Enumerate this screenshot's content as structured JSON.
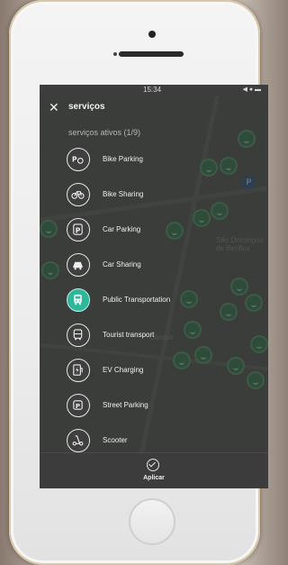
{
  "status_bar": {
    "time": "15:34",
    "icons": "◀ ● ▬"
  },
  "header": {
    "close_icon": "close-icon",
    "title": "serviços"
  },
  "subtitle": "serviços ativos (1/9)",
  "services": [
    {
      "label": "Bike Parking",
      "icon": "bike-parking-icon",
      "active": false
    },
    {
      "label": "Bike Sharing",
      "icon": "bike-icon",
      "active": false
    },
    {
      "label": "Car Parking",
      "icon": "car-parking-icon",
      "active": false
    },
    {
      "label": "Car Sharing",
      "icon": "car-icon",
      "active": false
    },
    {
      "label": "Public Transportation",
      "icon": "bus-icon",
      "active": true
    },
    {
      "label": "Tourist transport",
      "icon": "tourist-bus-icon",
      "active": false
    },
    {
      "label": "EV Charging",
      "icon": "ev-charging-icon",
      "active": false
    },
    {
      "label": "Street Parking",
      "icon": "street-parking-icon",
      "active": false
    },
    {
      "label": "Scooter",
      "icon": "scooter-icon",
      "active": false
    }
  ],
  "apply": {
    "label": "Aplicar",
    "icon": "check-circle-icon"
  },
  "colors": {
    "active": "#2fb79a",
    "overlay": "#4d4e4d",
    "marker": "#3f7a55"
  }
}
